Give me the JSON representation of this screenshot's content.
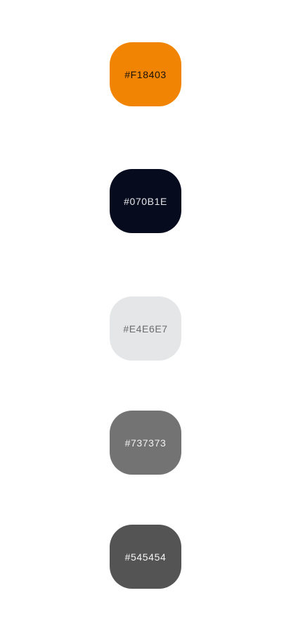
{
  "swatches": [
    {
      "label": "#F18403",
      "background": "#F18403",
      "text_color": "#1a1206"
    },
    {
      "label": "#070B1E",
      "background": "#070B1E",
      "text_color": "#e6e7ea"
    },
    {
      "label": "#E4E6E7",
      "background": "#E4E6E7",
      "text_color": "#6b6b6b"
    },
    {
      "label": "#737373",
      "background": "#737373",
      "text_color": "#f2f2f2"
    },
    {
      "label": "#545454",
      "background": "#545454",
      "text_color": "#f5f5f5"
    }
  ]
}
